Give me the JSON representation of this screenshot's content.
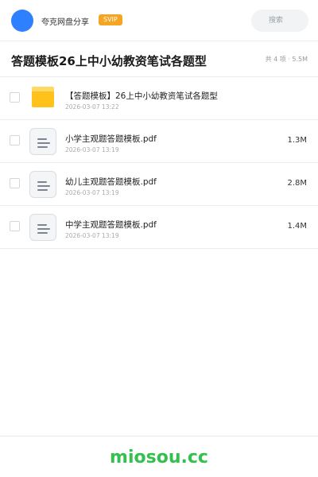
{
  "header": {
    "share_name": "夸克网盘分享",
    "badge": "SVIP",
    "search_placeholder": "搜索"
  },
  "folder": {
    "title": "答题模板26上中小幼教资笔试各题型",
    "summary": "共 4 项 · 5.5M"
  },
  "files": [
    {
      "type": "folder",
      "icon": "folder-icon",
      "name": "【答题模板】26上中小幼教资笔试各题型",
      "date": "2026-03-07 13:22",
      "size": ""
    },
    {
      "type": "file",
      "icon": "document-icon",
      "name": "小学主观题答题模板.pdf",
      "date": "2026-03-07 13:19",
      "size": "1.3M"
    },
    {
      "type": "file",
      "icon": "document-icon",
      "name": "幼儿主观题答题模板.pdf",
      "date": "2026-03-07 13:19",
      "size": "2.8M"
    },
    {
      "type": "file",
      "icon": "document-icon",
      "name": "中学主观题答题模板.pdf",
      "date": "2026-03-07 13:19",
      "size": "1.4M"
    }
  ],
  "footer": {
    "brand": "miosou.cc"
  },
  "colors": {
    "avatar": "#2f80ff",
    "badge": "#f5a524",
    "folder": "#ffc21a",
    "brand": "#34c04e"
  }
}
